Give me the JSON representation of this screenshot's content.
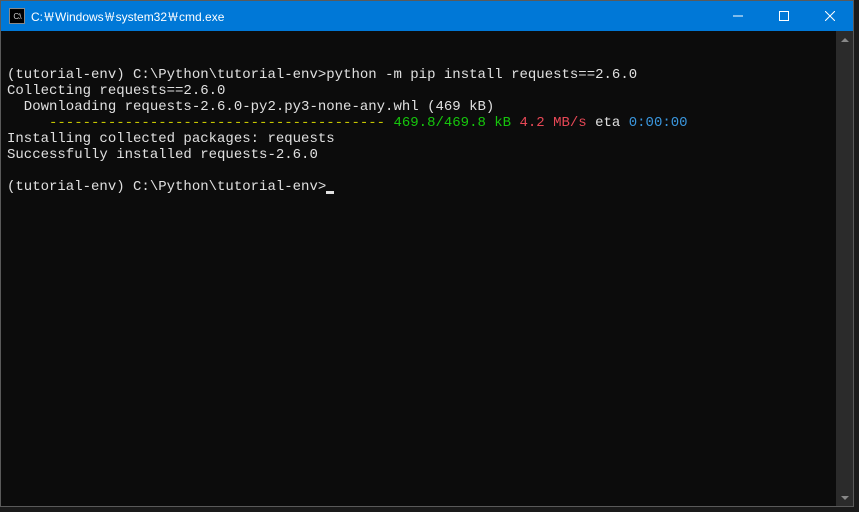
{
  "window": {
    "title": "C:￦Windows￦system32￦cmd.exe"
  },
  "terminal": {
    "line1_prompt": "(tutorial-env) C:\\Python\\tutorial-env>",
    "line1_cmd": "python -m pip install requests==2.6.0",
    "line2": "Collecting requests==2.6.0",
    "line3": "  Downloading requests-2.6.0-py2.py3-none-any.whl (469 kB)",
    "line4_bar": "     ---------------------------------------- ",
    "line4_size": "469.8/469.8 kB",
    "line4_speed": " 4.2 MB/s",
    "line4_eta_label": " eta ",
    "line4_eta": "0:00:00",
    "line5": "Installing collected packages: requests",
    "line6": "Successfully installed requests-2.6.0",
    "line8_prompt": "(tutorial-env) C:\\Python\\tutorial-env>"
  }
}
